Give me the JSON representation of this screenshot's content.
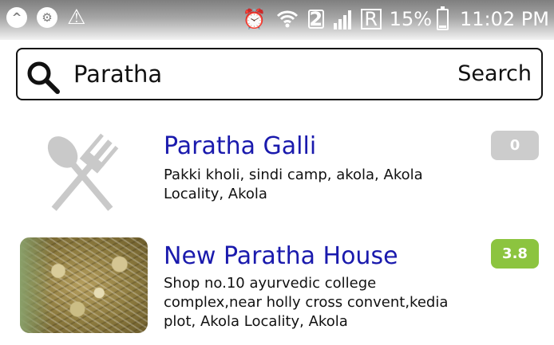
{
  "status_bar": {
    "left_icons": [
      "app-circle-icon",
      "settings-notification-icon",
      "warning-icon"
    ],
    "right_icons": [
      "alarm-icon",
      "wifi-icon",
      "sim-icon",
      "signal-icon",
      "roaming-icon",
      "battery-icon"
    ],
    "sim_number": "2",
    "roaming_label": "R",
    "battery_percent": "15%",
    "battery_level": 0.15,
    "time": "11:02 PM"
  },
  "search": {
    "icon": "search-icon",
    "query": "Paratha",
    "button_label": "Search"
  },
  "results": [
    {
      "name": "Paratha Galli",
      "address": "Pakki kholi, sindi camp, akola, Akola Locality, Akola",
      "rating": "0",
      "rating_color": "#cccccc",
      "thumbnail": "restaurant-placeholder-icon"
    },
    {
      "name": "New Paratha House",
      "address": "Shop no.10 ayurvedic college complex,near holly cross convent,kedia plot, Akola Locality, Akola",
      "rating": "3.8",
      "rating_color": "#8cc43f",
      "thumbnail": "food-photo"
    }
  ],
  "colors": {
    "title": "#1a1aad",
    "status_bar": "#9a9a9a"
  }
}
